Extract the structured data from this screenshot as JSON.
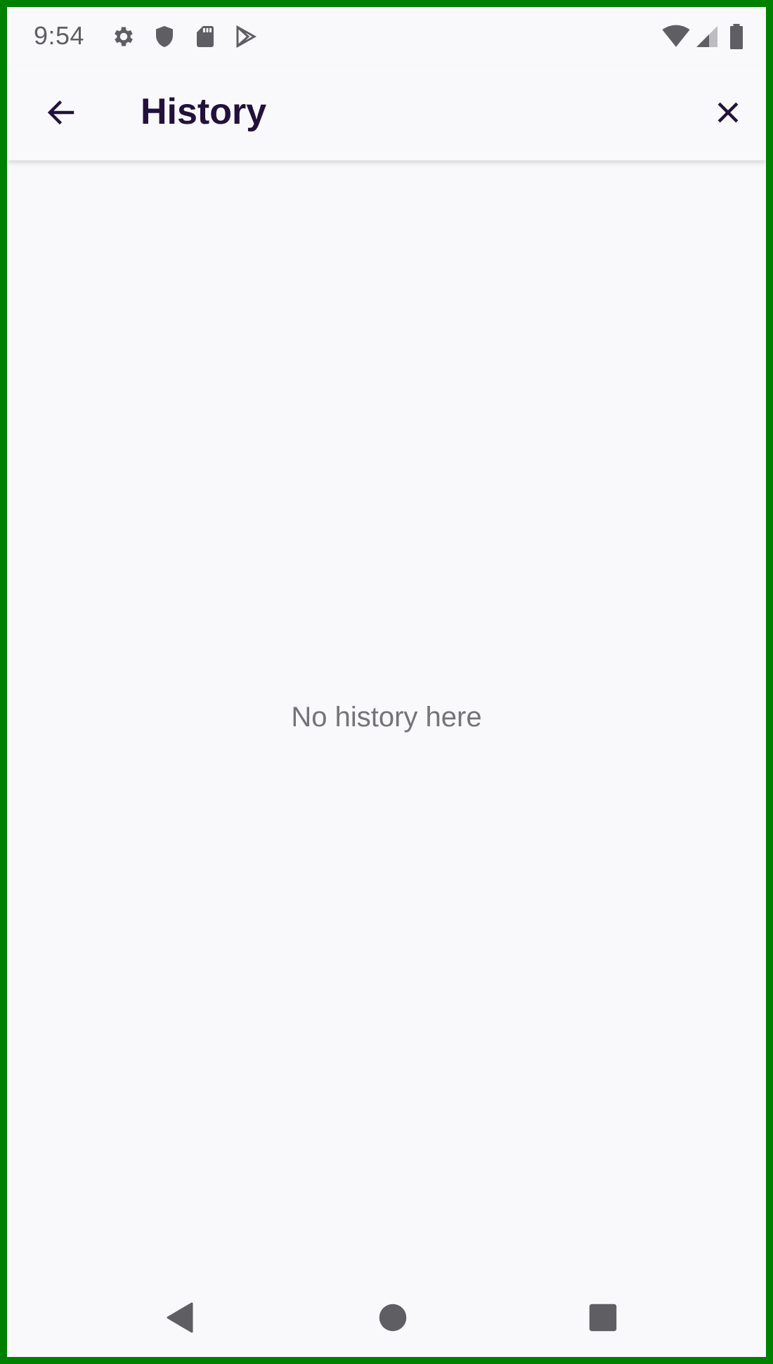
{
  "status_bar": {
    "time": "9:54",
    "left_icons": [
      "gear-icon",
      "shield-icon",
      "sd-card-icon",
      "play-store-icon"
    ],
    "right_icons": [
      "wifi-icon",
      "cell-signal-icon",
      "battery-icon"
    ],
    "icon_color": "#5f5f63"
  },
  "app_bar": {
    "title": "History",
    "back_icon": "arrow-left-icon",
    "close_icon": "close-icon",
    "title_color": "#22123a"
  },
  "main": {
    "empty_message": "No history here"
  },
  "nav_bar": {
    "buttons": [
      "back-triangle-icon",
      "home-circle-icon",
      "recents-square-icon"
    ]
  },
  "colors": {
    "frame_border": "#008000",
    "background": "#f9f9fb"
  }
}
